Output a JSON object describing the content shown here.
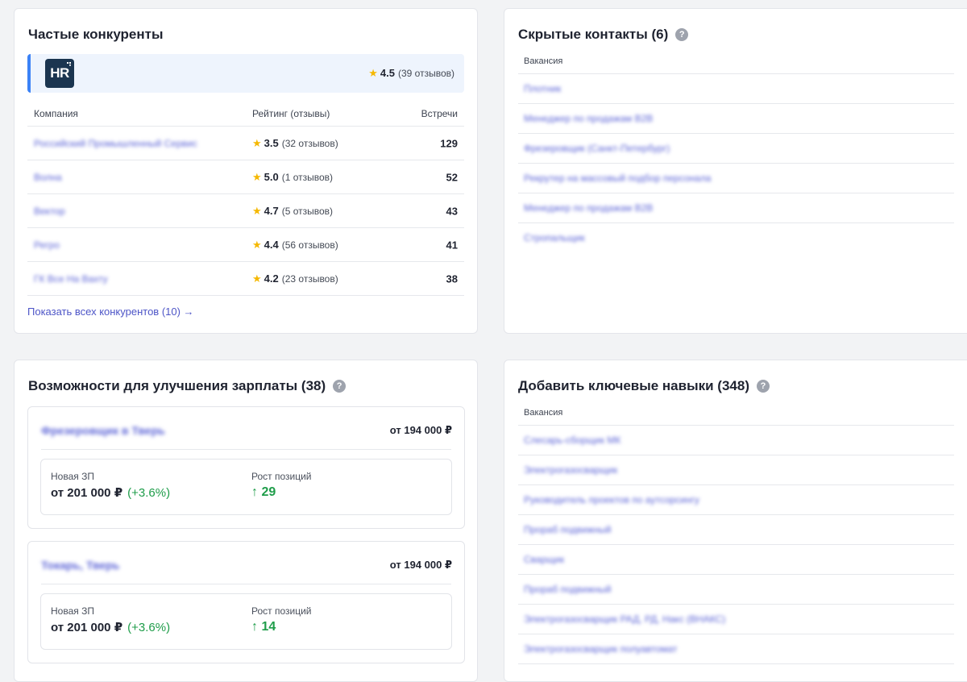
{
  "competitors": {
    "title": "Частые конкуренты",
    "own": {
      "logo": "HR",
      "rating": "4.5",
      "reviews": "(39 отзывов)"
    },
    "headers": {
      "company": "Компания",
      "rating": "Рейтинг (отзывы)",
      "meetings": "Встречи"
    },
    "rows": [
      {
        "name": "Российский Промышленный Сервис",
        "rating": "3.5",
        "reviews": "(32 отзывов)",
        "meetings": "129"
      },
      {
        "name": "Волна",
        "rating": "5.0",
        "reviews": "(1 отзывов)",
        "meetings": "52"
      },
      {
        "name": "Вектор",
        "rating": "4.7",
        "reviews": "(5 отзывов)",
        "meetings": "43"
      },
      {
        "name": "Регро",
        "rating": "4.4",
        "reviews": "(56 отзывов)",
        "meetings": "41"
      },
      {
        "name": "ГК Все На Вахту",
        "rating": "4.2",
        "reviews": "(23 отзывов)",
        "meetings": "38"
      }
    ],
    "show_all": "Показать всех конкурентов (10) →"
  },
  "hidden_contacts": {
    "title": "Скрытые контакты (6)",
    "help": "?",
    "header": "Вакансия",
    "rows": [
      "Плотник",
      "Менеджер по продажам B2B",
      "Фрезеровщик (Санкт-Петербург)",
      "Рекрутер на массовый подбор персонала",
      "Менеджер по продажам B2B",
      "Стропальщик"
    ]
  },
  "salary": {
    "title": "Возможности для улучшения зарплаты (38)",
    "help": "?",
    "offers": [
      {
        "title": "Фрезеровщик в Тверь",
        "salary": "от 194 000 ₽",
        "new_label": "Новая ЗП",
        "new_value": "от 201 000 ₽",
        "new_pct": "(+3.6%)",
        "growth_label": "Рост позиций",
        "growth_value": "↑ 29"
      },
      {
        "title": "Токарь, Тверь",
        "salary": "от 194 000 ₽",
        "new_label": "Новая ЗП",
        "new_value": "от 201 000 ₽",
        "new_pct": "(+3.6%)",
        "growth_label": "Рост позиций",
        "growth_value": "↑ 14"
      }
    ]
  },
  "skills": {
    "title": "Добавить ключевые навыки (348)",
    "help": "?",
    "header": "Вакансия",
    "rows": [
      "Слесарь-сборщик МК",
      "Электрогазосварщик",
      "Руководитель проектов по аутсорсингу",
      "Прораб подвижный",
      "Сварщик",
      "Прораб подвижный",
      "Электрогазосварщик РАД, РД, Накс (ВНАКС)",
      "Электрогазосварщик полуавтомат"
    ]
  },
  "colors": {
    "accent": "#5b63d6",
    "positive": "#1f9d4a",
    "star": "#f5b800",
    "highlight_bg": "#eef4fd"
  }
}
